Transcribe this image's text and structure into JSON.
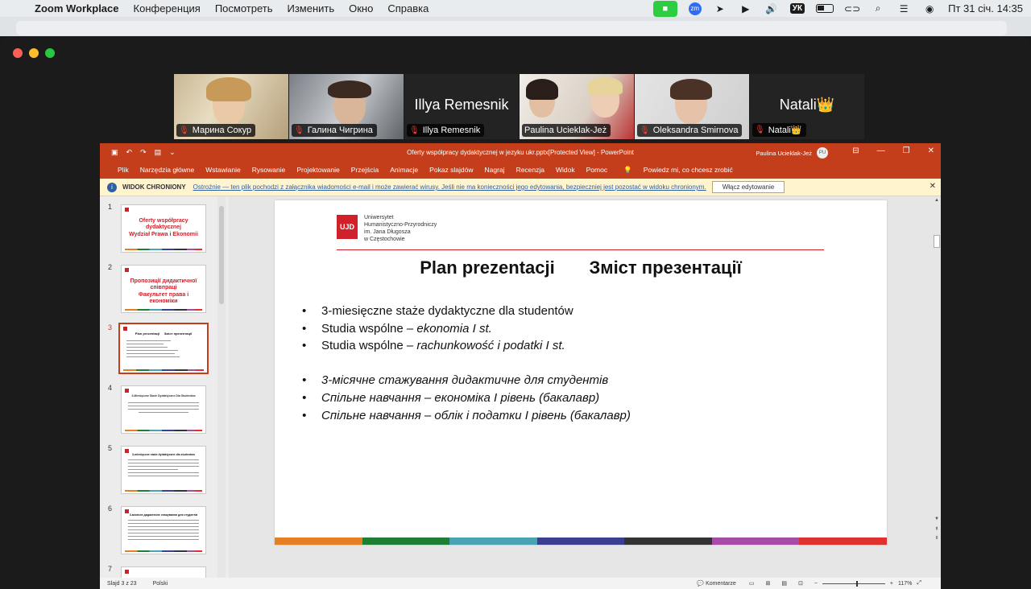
{
  "menubar": {
    "apple": "",
    "app": "Zoom Workplace",
    "items": [
      "Конференция",
      "Посмотреть",
      "Изменить",
      "Окно",
      "Справка"
    ],
    "keyboard": "УК",
    "zm_badge": "zm",
    "clock": "Пт 31 січ.  14:35"
  },
  "participants": [
    {
      "name": "Марина Сокур",
      "video": true
    },
    {
      "name": "Галина Чигрина",
      "video": true
    },
    {
      "name": "Illya Remesnik",
      "video": false,
      "big": "Illya Remesnik"
    },
    {
      "name": "Paulina Ucieklak-Jeż",
      "video": true,
      "active": true
    },
    {
      "name": "Oleksandra Smirnova",
      "video": true
    },
    {
      "name": "Natali👑",
      "video": false,
      "big": "Natali👑"
    }
  ],
  "ppt": {
    "doc_title": "Oferty współpracy dydaktycznej  w jezyku ukr.pptx[Protected View]  -  PowerPoint",
    "user": "Paulina Ucieklak-Jeż",
    "user_initials": "PU",
    "ribbon": [
      "Plik",
      "Narzędzia główne",
      "Wstawianie",
      "Rysowanie",
      "Projektowanie",
      "Przejścia",
      "Animacje",
      "Pokaz slajdów",
      "Nagraj",
      "Recenzja",
      "Widok",
      "Pomoc"
    ],
    "tell_me": "Powiedz mi, co chcesz zrobić",
    "protected": {
      "label": "WIDOK CHRONIONY",
      "message": "Ostrożnie — ten plik pochodzi z załącznika wiadomości e-mail i może zawierać wirusy. Jeśli nie ma konieczności jego edytowania, bezpieczniej jest pozostać w widoku chronionym.",
      "button": "Włącz edytowanie"
    },
    "thumbnails": [
      {
        "num": "1",
        "text": "Oferty współpracy\ndydaktycznej\nWydział Prawa i Ekonomii"
      },
      {
        "num": "2",
        "text": "Пропозиції дидактичної\nспівпраці\nФакультет права і економіки"
      },
      {
        "num": "3",
        "text": "Plan prezentacji     Зміст презентації",
        "selected": true
      },
      {
        "num": "4",
        "text": "3-Miesięczne Staże Dydaktyczne Dla Studentów"
      },
      {
        "num": "5",
        "text": "3-miesięczne staże dydaktyczne dla studentów"
      },
      {
        "num": "6",
        "text": "3-місячне дидактичне стажування для студентів"
      },
      {
        "num": "7",
        "text": ""
      }
    ],
    "slide": {
      "logo_text": "UJD",
      "university": [
        "Uniwersytet",
        "Humanistyczno-Przyrodniczy",
        "im. Jana Długosza",
        "w Częstochowie"
      ],
      "title": "Plan prezentacji       Зміст презентації",
      "bullets_pl": [
        {
          "plain": "3-miesięczne staże dydaktyczne dla studentów",
          "ital": ""
        },
        {
          "plain": "Studia wspólne – ",
          "ital": "ekonomia I st."
        },
        {
          "plain": "Studia wspólne – ",
          "ital": "rachunkowość i podatki I st."
        }
      ],
      "bullets_uk": [
        "3-місячне стажування дидактичне для студентів",
        "Спільне навчання – економіка I рівень (бакалавр)",
        "Спільне навчання – облік і податки I рівень (бакалавр)"
      ],
      "bar_colors": [
        "#e67e22",
        "#1e7e34",
        "#4aa3b5",
        "#3b3f8f",
        "#333333",
        "#a64ca6",
        "#e03131"
      ]
    },
    "status": {
      "slide": "Slajd 3 z 23",
      "lang": "Polski",
      "comments": "Komentarze",
      "zoom": "117%"
    }
  }
}
